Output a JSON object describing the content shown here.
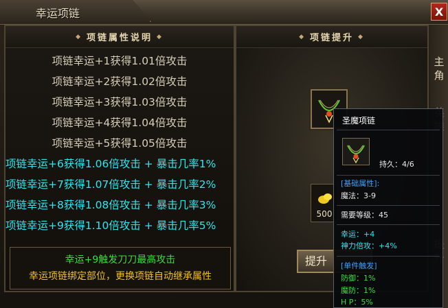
{
  "window": {
    "title": "幸运项链",
    "close_label": "X"
  },
  "left_panel": {
    "header": "项链属性说明",
    "normal_lines": [
      "项链幸运+1获得1.01倍攻击",
      "项链幸运+2获得1.02倍攻击",
      "项链幸运+3获得1.03倍攻击",
      "项链幸运+4获得1.04倍攻击",
      "项链幸运+5获得1.05倍攻击"
    ],
    "crit_lines": [
      "项链幸运+6获得1.06倍攻击 + 暴击几率1%",
      "项链幸运+7获得1.07倍攻击 + 暴击几率2%",
      "项链幸运+8获得1.08倍攻击 + 暴击几率3%",
      "项链幸运+9获得1.10倍攻击 + 暴击几率5%"
    ],
    "notice_green": "幸运+9触发刀刀最高攻击",
    "notice_yellow": "幸运项链绑定部位，更换项链自动继承属性"
  },
  "right_panel": {
    "header": "项链提升",
    "material_count": "500",
    "upgrade_label": "提升"
  },
  "side_tabs": {
    "tab1": "主角",
    "tab2": "英雄",
    "tab3": "提升"
  },
  "tooltip": {
    "name": "圣魔项链",
    "durability": "持久：4/6",
    "basic_header": "[基础属性]:",
    "magic": "魔法：3-9",
    "level_req": "需要等级：45",
    "luck": "幸运：+4",
    "holy_mult": "神力倍攻：+4%",
    "trigger_header": "[单件触发]",
    "defense": "防御：1%",
    "mdefense": "魔防：1%",
    "hp": "H P：5%"
  },
  "colors": {
    "cyan_text": "#2ee6ef",
    "green_text": "#3fdc3f",
    "yellow_text": "#f0c02a",
    "blue_text": "#3aa0ff"
  }
}
